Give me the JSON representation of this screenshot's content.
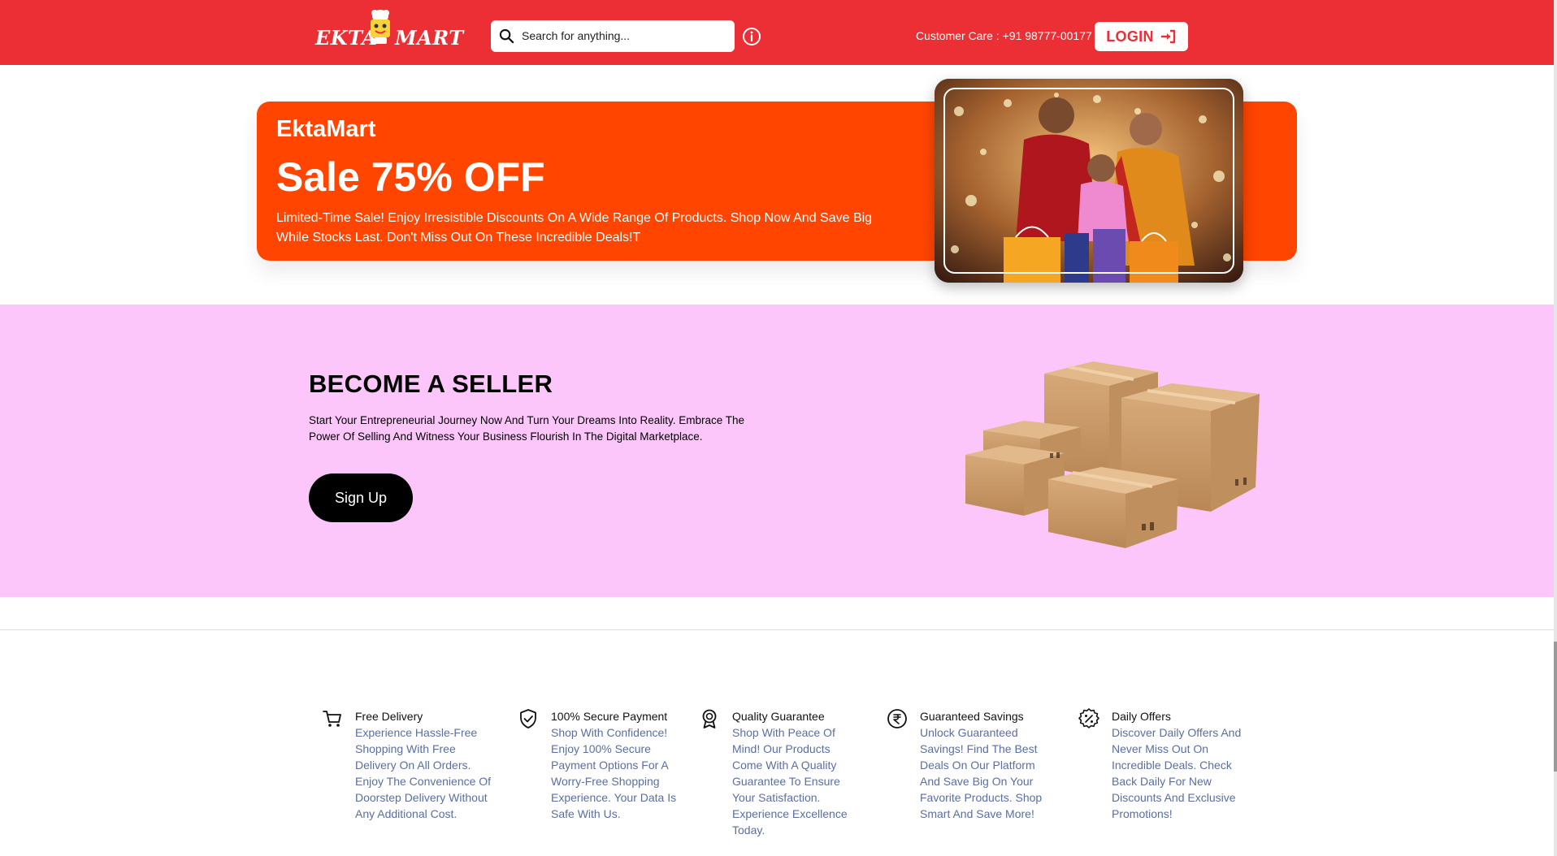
{
  "header": {
    "logo": {
      "left": "EKTA",
      "right": "MART"
    },
    "search": {
      "placeholder": "Search for anything..."
    },
    "customer_care": "Customer Care : +91 98777-00177",
    "login_label": "LOGIN"
  },
  "banner": {
    "brand": "EktaMart",
    "headline": "Sale 75% OFF",
    "description": "Limited-Time Sale! Enjoy Irresistible Discounts On A Wide Range Of Products. Shop Now And Save Big While Stocks Last. Don't Miss Out On These Incredible Deals!T"
  },
  "seller": {
    "title": "BECOME A SELLER",
    "description": "Start Your Entrepreneurial Journey Now And Turn Your Dreams Into Reality. Embrace The Power Of Selling And Witness Your Business Flourish In The Digital Marketplace.",
    "signup_label": "Sign Up"
  },
  "features": [
    {
      "icon": "cart-icon",
      "title": "Free Delivery",
      "description": "Experience Hassle-Free Shopping With Free Delivery On All Orders. Enjoy The Convenience Of Doorstep Delivery Without Any Additional Cost."
    },
    {
      "icon": "shield-check-icon",
      "title": "100% Secure Payment",
      "description": "Shop With Confidence! Enjoy 100% Secure Payment Options For A Worry-Free Shopping Experience. Your Data Is Safe With Us."
    },
    {
      "icon": "award-badge-icon",
      "title": "Quality Guarantee",
      "description": "Shop With Peace Of Mind! Our Products Come With A Quality Guarantee To Ensure Your Satisfaction. Experience Excellence Today."
    },
    {
      "icon": "rupee-icon",
      "title": "Guaranteed Savings",
      "description": "Unlock Guaranteed Savings! Find The Best Deals On Our Platform And Save Big On Your Favorite Products. Shop Smart And Save More!"
    },
    {
      "icon": "discount-icon",
      "title": "Daily Offers",
      "description": "Discover Daily Offers And Never Miss Out On Incredible Deals. Check Back Daily For New Discounts And Exclusive Promotions!"
    }
  ],
  "colors": {
    "header_red": "#ec2f34",
    "banner_orange": "#ff4500",
    "seller_pink": "#fdc6fb",
    "feature_text_blue": "#5a6fa0"
  }
}
